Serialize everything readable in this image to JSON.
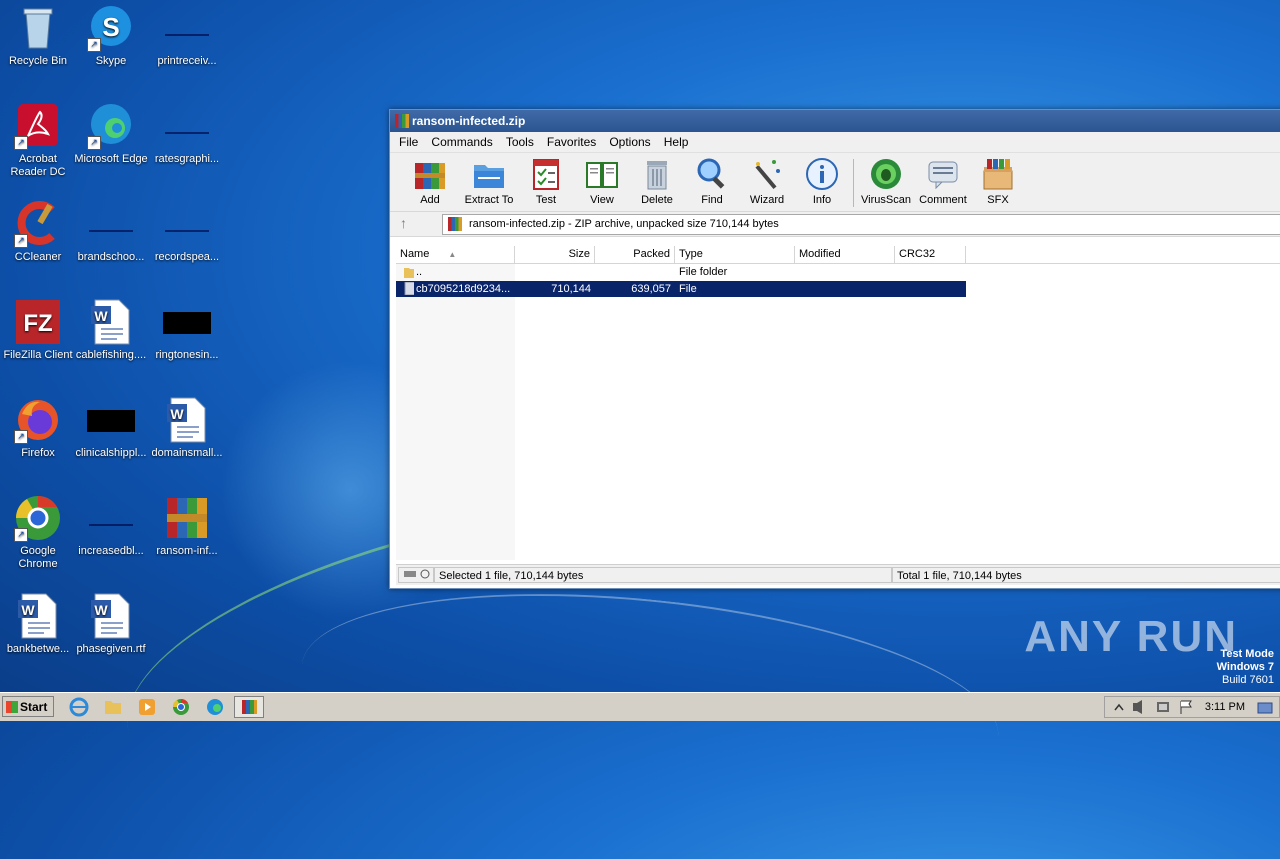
{
  "desktop": {
    "icons": [
      {
        "label": "Recycle Bin",
        "icon": "recycle-bin-icon"
      },
      {
        "label": "Skype",
        "icon": "skype-icon"
      },
      {
        "label": "printreceiv...",
        "icon": "blank-file-icon"
      },
      {
        "label": "Acrobat Reader DC",
        "icon": "acrobat-icon"
      },
      {
        "label": "Microsoft Edge",
        "icon": "edge-icon"
      },
      {
        "label": "ratesgraphi...",
        "icon": "blank-file-icon"
      },
      {
        "label": "CCleaner",
        "icon": "ccleaner-icon"
      },
      {
        "label": "brandschoo...",
        "icon": "blank-file-icon"
      },
      {
        "label": "recordspea...",
        "icon": "blank-file-icon"
      },
      {
        "label": "FileZilla Client",
        "icon": "filezilla-icon"
      },
      {
        "label": "cablefishing....",
        "icon": "word-doc-icon"
      },
      {
        "label": "ringtonesin...",
        "icon": "black-file-icon"
      },
      {
        "label": "Firefox",
        "icon": "firefox-icon"
      },
      {
        "label": "clinicalshippl...",
        "icon": "black-file-icon"
      },
      {
        "label": "domainsmall...",
        "icon": "word-doc-icon"
      },
      {
        "label": "Google Chrome",
        "icon": "chrome-icon"
      },
      {
        "label": "increasedbl...",
        "icon": "blank-file-icon"
      },
      {
        "label": "ransom-inf...",
        "icon": "winrar-icon"
      },
      {
        "label": "bankbetwe...",
        "icon": "word-doc-icon"
      },
      {
        "label": "phasegiven.rtf",
        "icon": "word-doc-icon"
      }
    ]
  },
  "window": {
    "title": "ransom-infected.zip",
    "menu": [
      "File",
      "Commands",
      "Tools",
      "Favorites",
      "Options",
      "Help"
    ],
    "toolbar": [
      "Add",
      "Extract To",
      "Test",
      "View",
      "Delete",
      "Find",
      "Wizard",
      "Info",
      "VirusScan",
      "Comment",
      "SFX"
    ],
    "address": "ransom-infected.zip - ZIP archive, unpacked size 710,144 bytes",
    "columns": [
      "Name",
      "Size",
      "Packed",
      "Type",
      "Modified",
      "CRC32"
    ],
    "rows": [
      {
        "name": "..",
        "size": "",
        "packed": "",
        "type": "File folder",
        "modified": "",
        "crc": ""
      },
      {
        "name": "cb7095218d9234...",
        "size": "710,144",
        "packed": "639,057",
        "type": "File",
        "modified": "",
        "crc": ""
      }
    ],
    "status_left": "Selected 1 file, 710,144 bytes",
    "status_right": "Total 1 file, 710,144 bytes"
  },
  "taskbar": {
    "start_label": "Start",
    "clock": "3:11 PM"
  },
  "watermark": "ANY RUN",
  "testmode": {
    "line1": "Test Mode",
    "line2": "Windows 7",
    "line3": "Build 7601"
  },
  "colors": {
    "selection": "#0a246a",
    "titlebar": "#2b5590"
  }
}
